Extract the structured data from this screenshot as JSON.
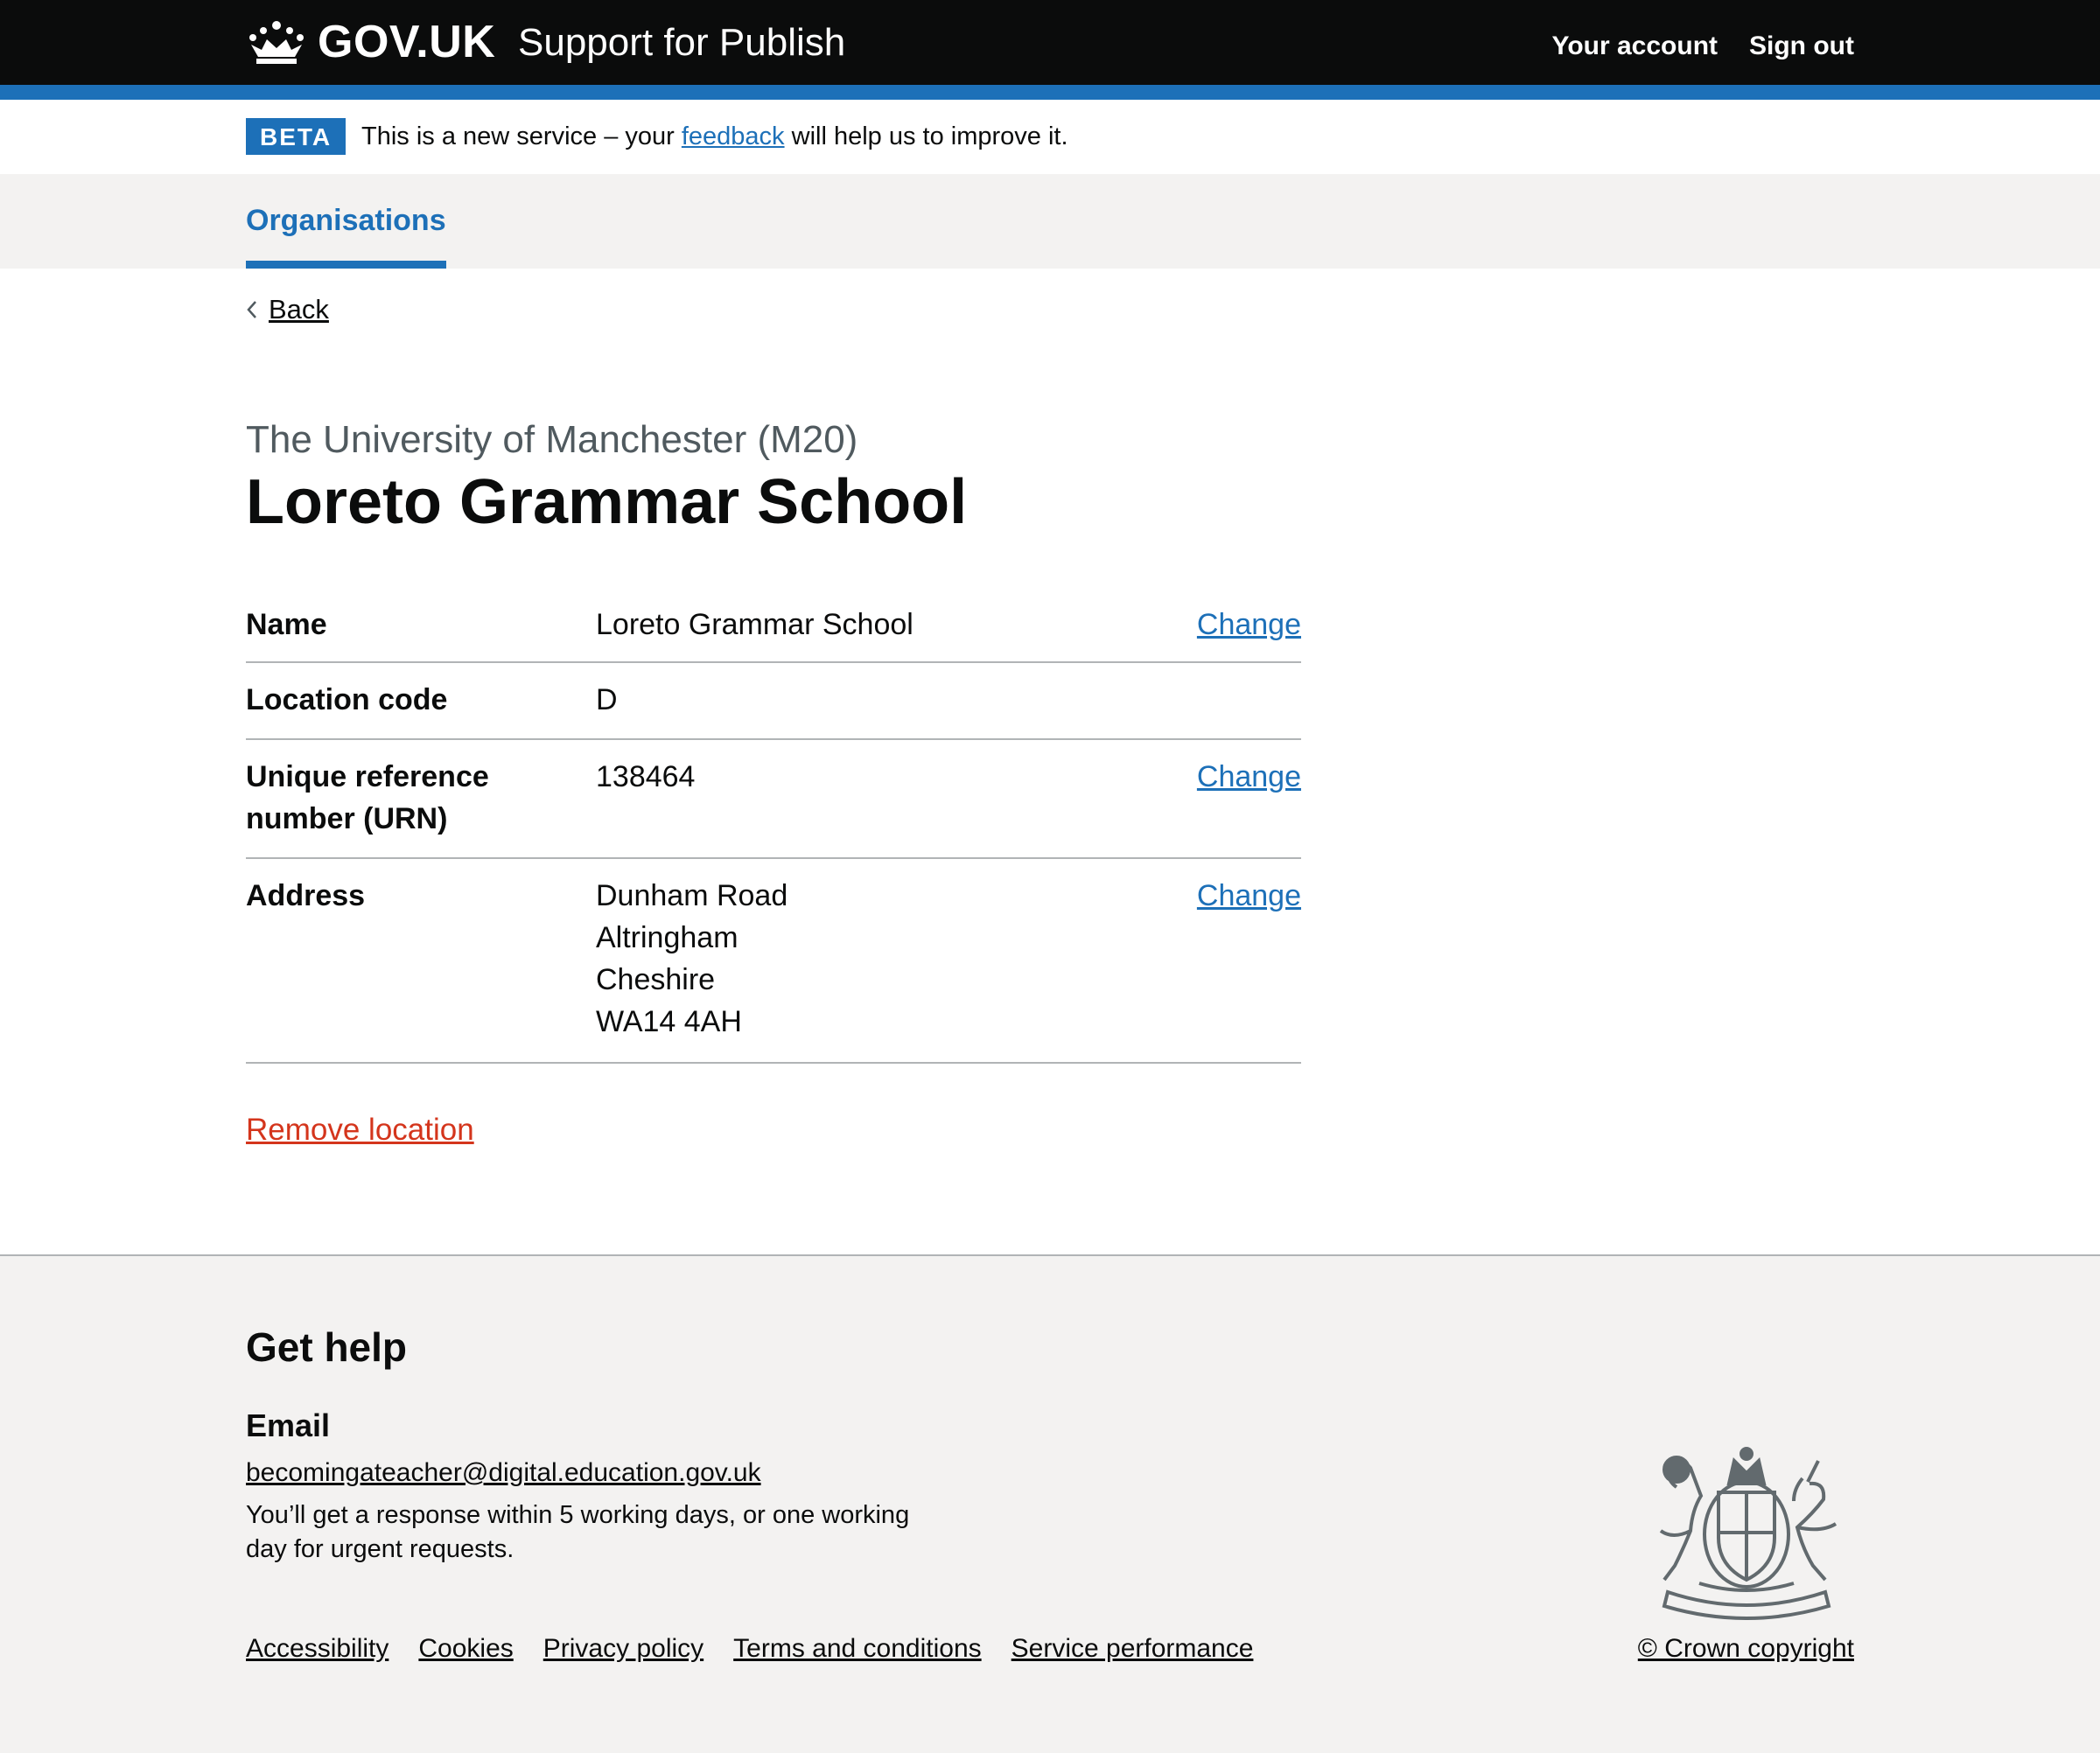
{
  "header": {
    "logo_text": "GOV.UK",
    "service_name": "Support for Publish",
    "nav": [
      "Your account",
      "Sign out"
    ]
  },
  "phase_banner": {
    "tag": "BETA",
    "text_before": "This is a new service – your ",
    "link_text": "feedback",
    "text_after": " will help us to improve it."
  },
  "primary_nav": {
    "active_item": "Organisations"
  },
  "back_link": "Back",
  "page": {
    "caption": "The University of Manchester (M20)",
    "title": "Loreto Grammar School"
  },
  "summary": [
    {
      "key": "Name",
      "value": [
        "Loreto Grammar School"
      ],
      "action": "Change"
    },
    {
      "key": "Location code",
      "value": [
        "D"
      ],
      "action": ""
    },
    {
      "key": "Unique reference number (URN)",
      "value": [
        "138464"
      ],
      "action": "Change"
    },
    {
      "key": "Address",
      "value": [
        "Dunham Road",
        "Altringham",
        "Cheshire",
        "WA14 4AH"
      ],
      "action": "Change"
    }
  ],
  "remove_link": "Remove location",
  "footer": {
    "help_title": "Get help",
    "email_label": "Email",
    "email": "becomingateacher@digital.education.gov.uk",
    "response_text": "You’ll get a response within 5 working days, or one working day for urgent requests.",
    "links": [
      "Accessibility",
      "Cookies",
      "Privacy policy",
      "Terms and conditions",
      "Service performance"
    ],
    "copyright": "© Crown copyright"
  },
  "colors": {
    "header_bg": "#0b0c0c",
    "brand_blue": "#1d70b8",
    "link": "#1d70b8",
    "danger": "#d4351c",
    "footer_bg": "#f3f2f1",
    "border": "#b1b4b6"
  }
}
